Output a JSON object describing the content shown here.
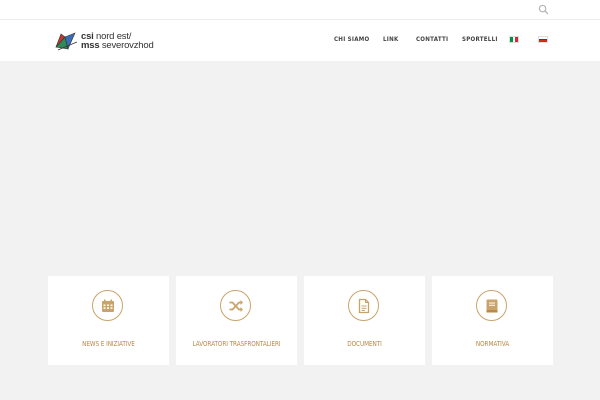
{
  "topbar": {
    "search_icon": "search-icon"
  },
  "logo": {
    "line1_bold": "csi",
    "line1_rest": " nord est/",
    "line2_bold": "mss",
    "line2_rest": " severovzhod",
    "colors": [
      "#c0392b",
      "#2e8b57",
      "#3a6db5"
    ]
  },
  "nav": {
    "items": [
      "CHI SIAMO",
      "LINK",
      "CONTATTI",
      "SPORTELLI"
    ],
    "flags": [
      {
        "lang": "it",
        "colors": [
          "#009246",
          "#ffffff",
          "#ce2b37"
        ]
      },
      {
        "lang": "sl",
        "colors": [
          "#ffffff",
          "#0c4ea2",
          "#d52b1e"
        ]
      }
    ]
  },
  "cards": [
    {
      "icon": "calendar-icon",
      "label": "NEWS E INIZIATIVE"
    },
    {
      "icon": "shuffle-icon",
      "label": "LAVORATORI TRASFRONTALIERI"
    },
    {
      "icon": "document-icon",
      "label": "DOCUMENTI"
    },
    {
      "icon": "book-icon",
      "label": "NORMATIVA"
    }
  ],
  "colors": {
    "accent": "#c9a46a",
    "label": "#b8894a",
    "background": "#f2f2f2"
  }
}
